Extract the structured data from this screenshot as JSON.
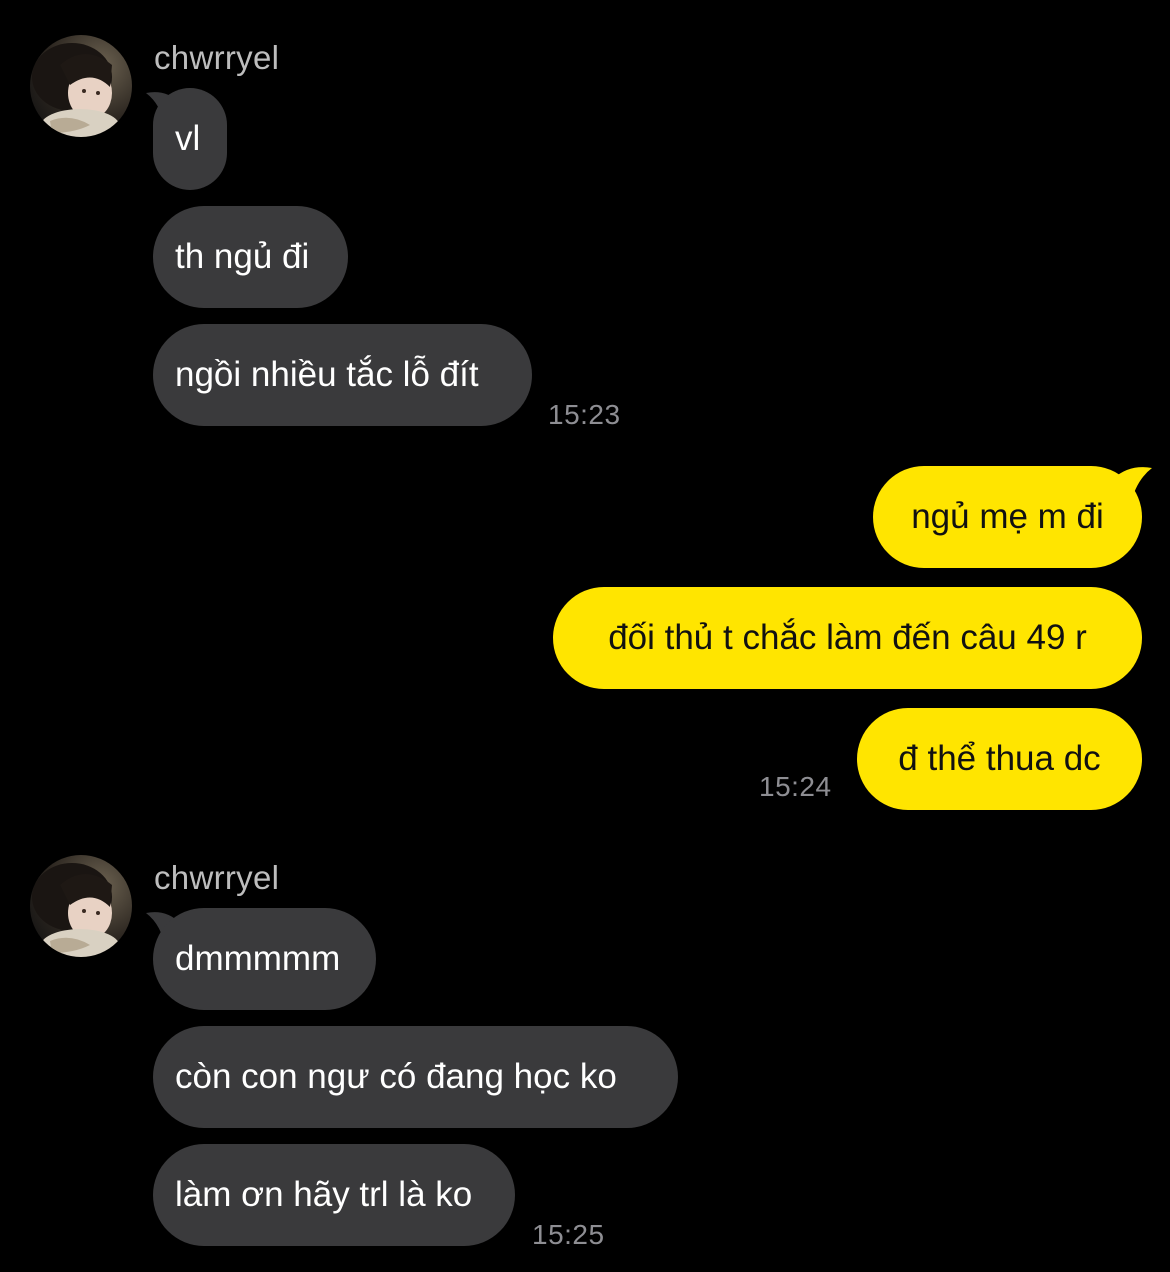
{
  "colors": {
    "background": "#000000",
    "incoming_bubble": "#3a3a3c",
    "outgoing_bubble": "#ffe500",
    "sender_name": "#bdbdbd",
    "timestamp": "#8e8e93"
  },
  "groups": [
    {
      "sender": "chwrryel",
      "avatar_icon": "profile-photo",
      "messages": [
        "vl",
        "th ngủ đi",
        "ngồi nhiều tắc lỗ đít"
      ],
      "time": "15:23"
    },
    {
      "sender": "me",
      "messages": [
        "ngủ mẹ m đi",
        "đối thủ t chắc làm đến câu 49 r",
        "đ thể thua dc"
      ],
      "time": "15:24"
    },
    {
      "sender": "chwrryel",
      "avatar_icon": "profile-photo",
      "messages": [
        "dmmmmm",
        "còn con ngư có đang học ko",
        "làm ơn hãy trl là ko"
      ],
      "time": "15:25"
    }
  ]
}
